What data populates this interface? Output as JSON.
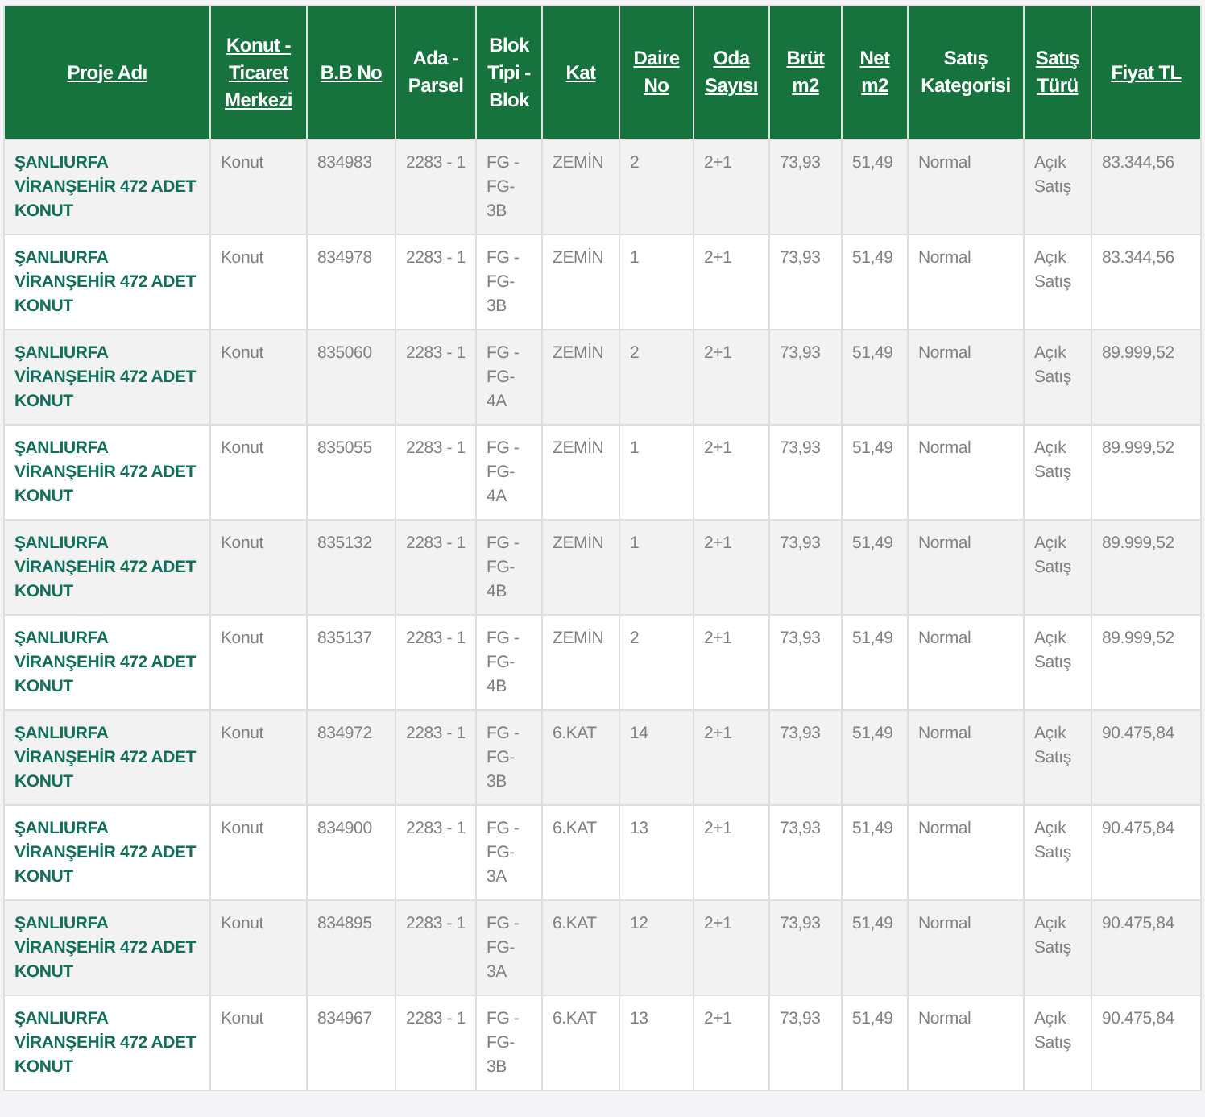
{
  "table": {
    "columns": [
      {
        "label": "Proje Adı",
        "sortable": true
      },
      {
        "label": "Konut - Ticaret Merkezi",
        "sortable": true
      },
      {
        "label": "B.B No",
        "sortable": true
      },
      {
        "label": "Ada - Parsel",
        "sortable": false
      },
      {
        "label": "Blok Tipi - Blok",
        "sortable": false
      },
      {
        "label": "Kat",
        "sortable": true
      },
      {
        "label": "Daire No",
        "sortable": true
      },
      {
        "label": "Oda Sayısı",
        "sortable": true
      },
      {
        "label": "Brüt m2",
        "sortable": true
      },
      {
        "label": "Net m2",
        "sortable": true
      },
      {
        "label": "Satış Kategorisi",
        "sortable": false
      },
      {
        "label": "Satış Türü",
        "sortable": true
      },
      {
        "label": "Fiyat TL",
        "sortable": true
      }
    ],
    "rows": [
      [
        "ŞANLIURFA VİRANŞEHİR 472 ADET KONUT",
        "Konut",
        "834983",
        "2283 - 1",
        "FG - FG- 3B",
        "ZEMİN",
        "2",
        "2+1",
        "73,93",
        "51,49",
        "Normal",
        "Açık Satış",
        "83.344,56"
      ],
      [
        "ŞANLIURFA VİRANŞEHİR 472 ADET KONUT",
        "Konut",
        "834978",
        "2283 - 1",
        "FG - FG- 3B",
        "ZEMİN",
        "1",
        "2+1",
        "73,93",
        "51,49",
        "Normal",
        "Açık Satış",
        "83.344,56"
      ],
      [
        "ŞANLIURFA VİRANŞEHİR 472 ADET KONUT",
        "Konut",
        "835060",
        "2283 - 1",
        "FG - FG- 4A",
        "ZEMİN",
        "2",
        "2+1",
        "73,93",
        "51,49",
        "Normal",
        "Açık Satış",
        "89.999,52"
      ],
      [
        "ŞANLIURFA VİRANŞEHİR 472 ADET KONUT",
        "Konut",
        "835055",
        "2283 - 1",
        "FG - FG- 4A",
        "ZEMİN",
        "1",
        "2+1",
        "73,93",
        "51,49",
        "Normal",
        "Açık Satış",
        "89.999,52"
      ],
      [
        "ŞANLIURFA VİRANŞEHİR 472 ADET KONUT",
        "Konut",
        "835132",
        "2283 - 1",
        "FG - FG- 4B",
        "ZEMİN",
        "1",
        "2+1",
        "73,93",
        "51,49",
        "Normal",
        "Açık Satış",
        "89.999,52"
      ],
      [
        "ŞANLIURFA VİRANŞEHİR 472 ADET KONUT",
        "Konut",
        "835137",
        "2283 - 1",
        "FG - FG- 4B",
        "ZEMİN",
        "2",
        "2+1",
        "73,93",
        "51,49",
        "Normal",
        "Açık Satış",
        "89.999,52"
      ],
      [
        "ŞANLIURFA VİRANŞEHİR 472 ADET KONUT",
        "Konut",
        "834972",
        "2283 - 1",
        "FG - FG- 3B",
        "6.KAT",
        "14",
        "2+1",
        "73,93",
        "51,49",
        "Normal",
        "Açık Satış",
        "90.475,84"
      ],
      [
        "ŞANLIURFA VİRANŞEHİR 472 ADET KONUT",
        "Konut",
        "834900",
        "2283 - 1",
        "FG - FG- 3A",
        "6.KAT",
        "13",
        "2+1",
        "73,93",
        "51,49",
        "Normal",
        "Açık Satış",
        "90.475,84"
      ],
      [
        "ŞANLIURFA VİRANŞEHİR 472 ADET KONUT",
        "Konut",
        "834895",
        "2283 - 1",
        "FG - FG- 3A",
        "6.KAT",
        "12",
        "2+1",
        "73,93",
        "51,49",
        "Normal",
        "Açık Satış",
        "90.475,84"
      ],
      [
        "ŞANLIURFA VİRANŞEHİR 472 ADET KONUT",
        "Konut",
        "834967",
        "2283 - 1",
        "FG - FG- 3B",
        "6.KAT",
        "13",
        "2+1",
        "73,93",
        "51,49",
        "Normal",
        "Açık Satış",
        "90.475,84"
      ]
    ]
  }
}
